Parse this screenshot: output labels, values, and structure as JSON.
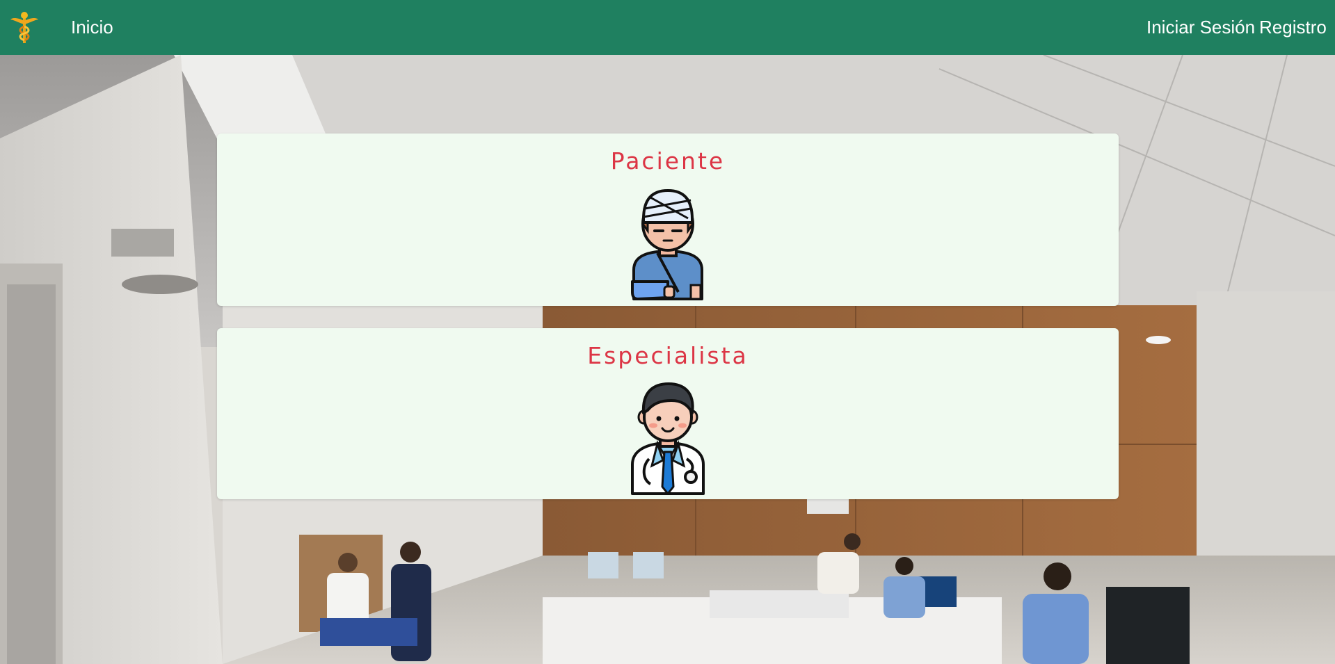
{
  "navbar": {
    "logo_icon": "caduceus-icon",
    "home_label": "Inicio",
    "login_label": "Iniciar Sesión",
    "register_label": "Registro",
    "background_color": "#1f8060"
  },
  "background": {
    "icon": "hospital-hallway-photo"
  },
  "cards": {
    "patient": {
      "title": "Paciente",
      "icon": "bandaged-patient-icon"
    },
    "specialist": {
      "title": "Especialista",
      "icon": "doctor-with-stethoscope-icon"
    },
    "title_color": "#dc3545",
    "background_color": "#f0faf0"
  }
}
